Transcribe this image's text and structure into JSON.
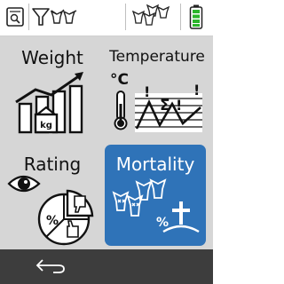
{
  "toolbar": {
    "icons": [
      "report-icon",
      "filter-cow-icon",
      "cow-group-icon",
      "battery-icon"
    ],
    "battery_color": "#2bb52b"
  },
  "tiles": {
    "weight": {
      "label": "Weight"
    },
    "temperature": {
      "label": "Temperature",
      "unit": "°C",
      "sigma": "Σ",
      "bang": "!"
    },
    "rating": {
      "label": "Rating",
      "percent": "%"
    },
    "mortality": {
      "label": "Mortality",
      "percent": "%",
      "selected": true
    }
  },
  "weight_icon": {
    "kg": "kg"
  },
  "colors": {
    "selected_tile": "#2f73b8",
    "background": "#d6d6d6",
    "bottom_bar": "#3d3d3d"
  }
}
